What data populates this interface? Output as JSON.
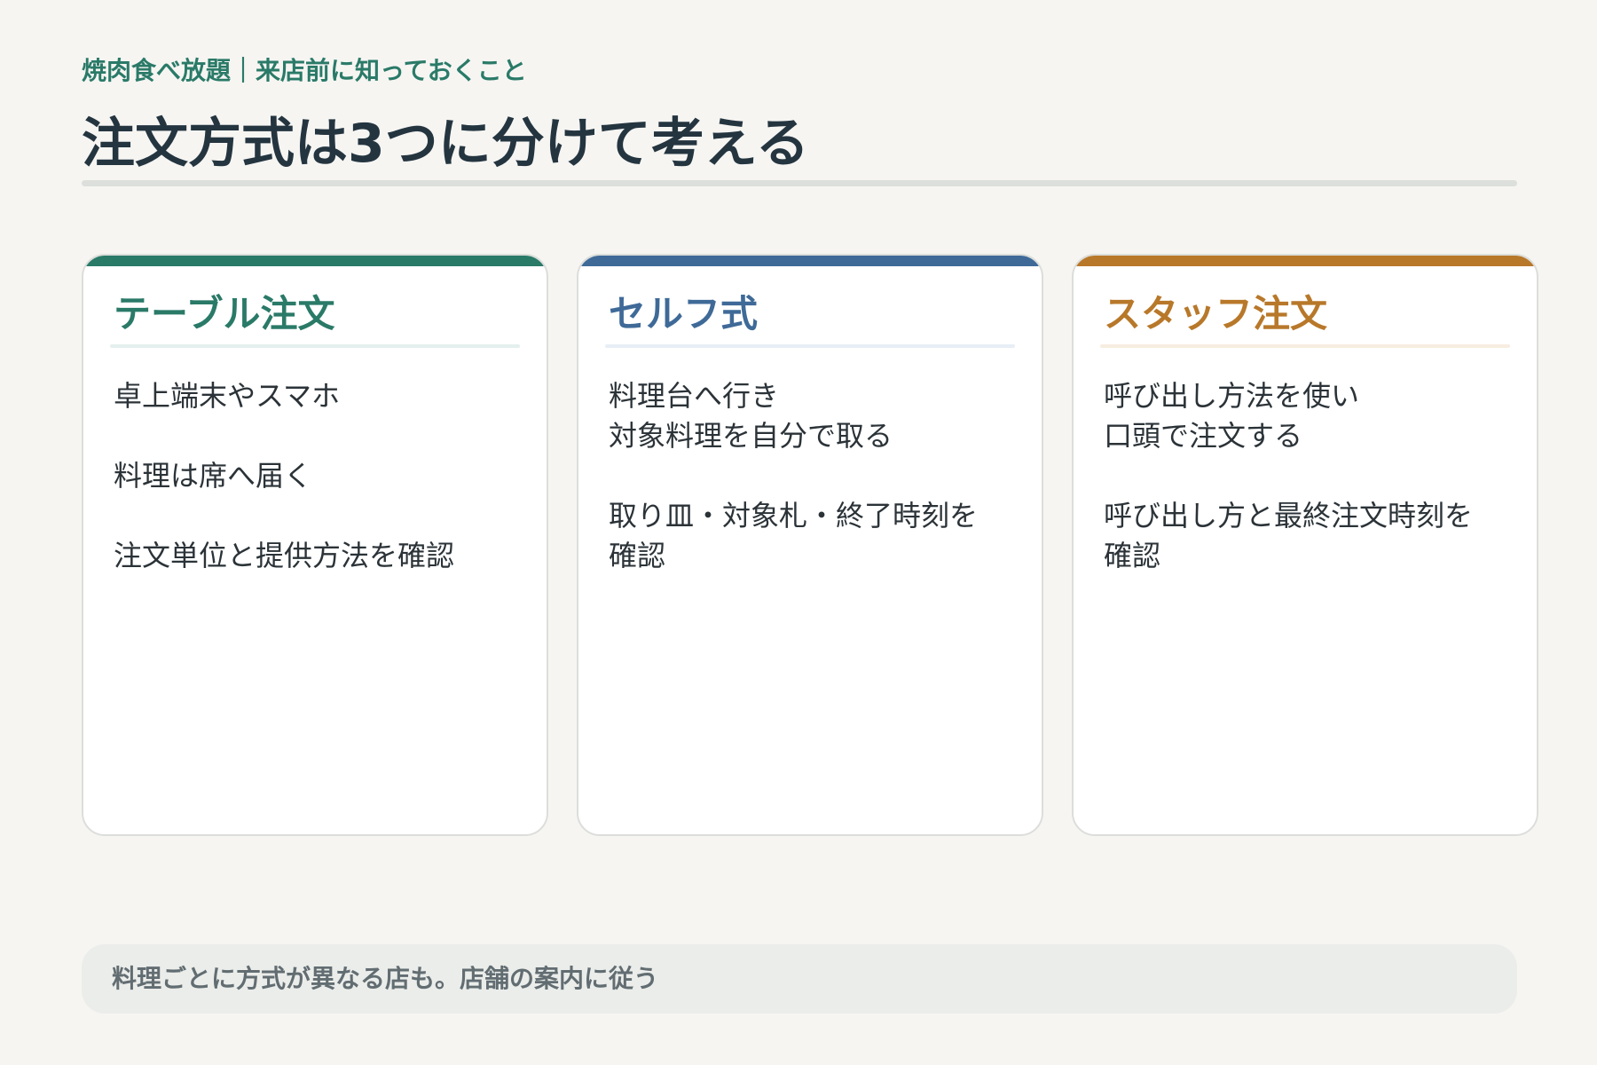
{
  "header": {
    "eyebrow": "焼肉食べ放題｜来店前に知っておくこと",
    "title": "注文方式は3つに分けて考える"
  },
  "cards": [
    {
      "title": "テーブル注文",
      "accent_color": "#2a7a68",
      "rule_color": "#e4f0ed",
      "items": [
        "卓上端末やスマホ",
        "料理は席へ届く",
        "注文単位と提供方法を確認"
      ]
    },
    {
      "title": "セルフ式",
      "accent_color": "#3f6a98",
      "rule_color": "#e8eef5",
      "items": [
        "料理台へ行き\n対象料理を自分で取る",
        "取り皿・対象札・終了時刻を\n確認"
      ]
    },
    {
      "title": "スタッフ注文",
      "accent_color": "#b8782a",
      "rule_color": "#f7ede0",
      "items": [
        "呼び出し方法を使い\n口頭で注文する",
        "呼び出し方と最終注文時刻を\n確認"
      ]
    }
  ],
  "footer": {
    "note": "料理ごとに方式が異なる店も。店舗の案内に従う"
  }
}
